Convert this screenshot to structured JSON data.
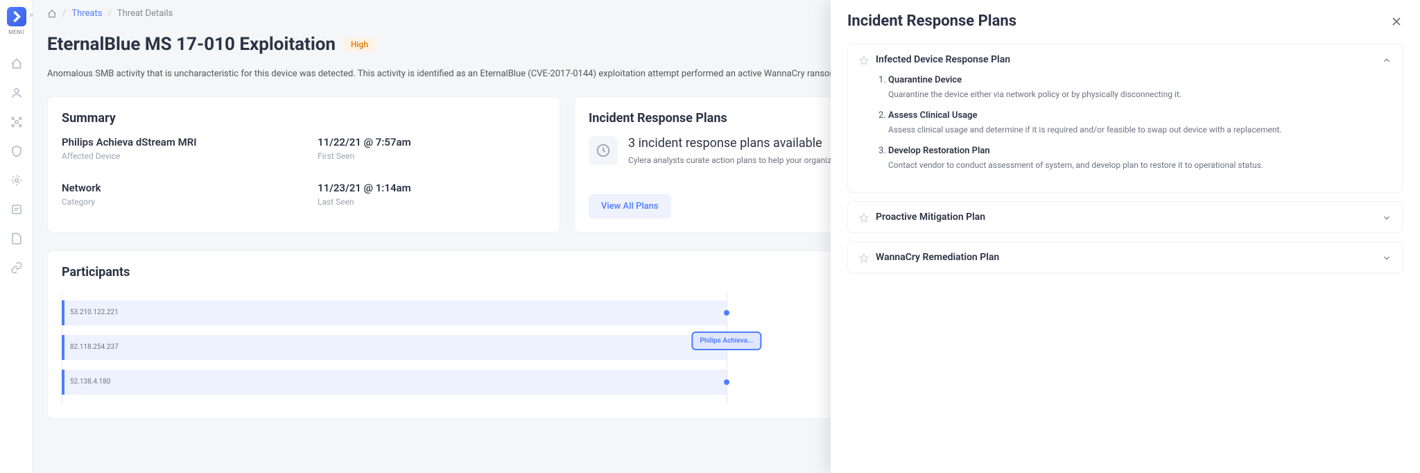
{
  "menu_label": "MENU",
  "breadcrumb": {
    "threats": "Threats",
    "current": "Threat Details"
  },
  "title": "EternalBlue MS 17-010 Exploitation",
  "severity": "High",
  "description": "Anomalous SMB activity that is uncharacteristic for this device was detected. This activity is identified as an EternalBlue (CVE-2017-0144) exploitation attempt performed an active WannaCry ransomware infection on the device. This malware attempts to aggressively spread both laterally within",
  "summary": {
    "title": "Summary",
    "device_value": "Philips Achieva dStream MRI",
    "device_label": "Affected Device",
    "first_seen_value": "11/22/21 @ 7:57am",
    "first_seen_label": "First Seen",
    "category_value": "Network",
    "category_label": "Category",
    "last_seen_value": "11/23/21 @ 1:14am",
    "last_seen_label": "Last Seen"
  },
  "irp": {
    "title": "Incident Response Plans",
    "headline": "3 incident response plans available",
    "sub": "Cylera analysts curate action plans to help your organization respond to potentially ad",
    "view_all": "View All Plans"
  },
  "participants": {
    "title": "Participants",
    "bars": [
      "53.210.122.221",
      "82.118.254.237",
      "52.138.4.180"
    ],
    "node": "Philips Achieva..."
  },
  "drawer": {
    "title": "Incident Response Plans",
    "plan1": {
      "title": "Infected Device Response Plan",
      "steps": [
        {
          "title": "Quarantine Device",
          "desc": "Quarantine the device either via network policy or by physically disconnecting it."
        },
        {
          "title": "Assess Clinical Usage",
          "desc": "Assess clinical usage and determine if it is required and/or feasible to swap out device with a replacement."
        },
        {
          "title": "Develop Restoration Plan",
          "desc": "Contact vendor to conduct assessment of system, and develop plan to restore it to operational status."
        }
      ]
    },
    "plan2": {
      "title": "Proactive Mitigation Plan"
    },
    "plan3": {
      "title": "WannaCry Remediation Plan"
    }
  }
}
